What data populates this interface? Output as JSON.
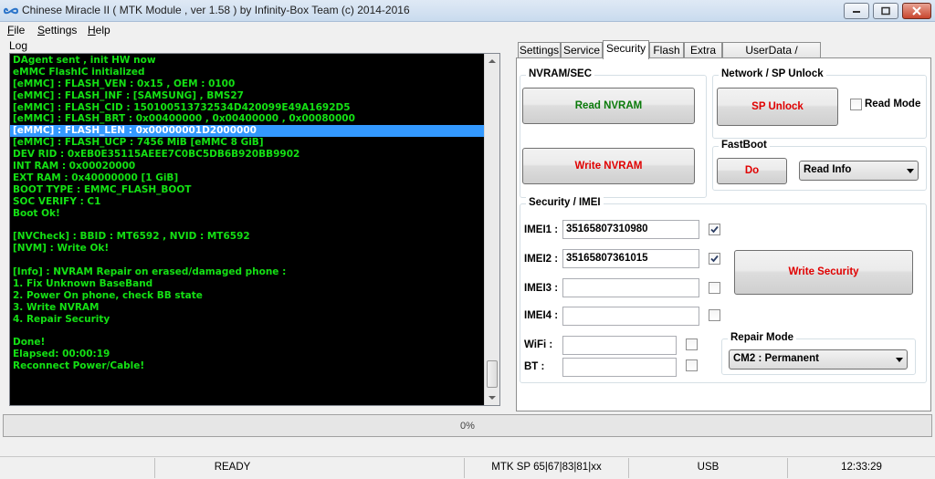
{
  "window": {
    "title": "Chinese Miracle II ( MTK Module , ver 1.58 ) by Infinity-Box Team (c) 2014-2016",
    "icon": "infinity-icon"
  },
  "menu": [
    "File",
    "Settings",
    "Help"
  ],
  "log": {
    "label": "Log",
    "lines": [
      "DAgent sent , init HW now",
      "eMMC FlashIC initialized",
      "[eMMC] : FLASH_VEN : 0x15 , OEM : 0100",
      "[eMMC] : FLASH_INF : [SAMSUNG] , BMS27",
      "[eMMC] : FLASH_CID : 150100513732534D420099E49A1692D5",
      "[eMMC] : FLASH_BRT : 0x00400000 , 0x00400000 , 0x00080000",
      "[eMMC] : FLASH_LEN : 0x00000001D2000000",
      "[eMMC] : FLASH_UCP : 7456 MiB [eMMC 8 GiB]",
      "DEV RID    : 0xEB0E35115AEEE7C0BC5DB6B920BB9902",
      "INT RAM    : 0x00020000",
      "EXT RAM    : 0x40000000 [1 GiB]",
      "BOOT TYPE  : EMMC_FLASH_BOOT",
      "SOC VERIFY : C1",
      "Boot Ok!",
      "",
      "[NVCheck] : BBID : MT6592 , NVID : MT6592",
      "[NVM] : Write Ok!",
      "",
      "[Info] : NVRAM Repair on erased/damaged phone :",
      "1. Fix Unknown BaseBand",
      "2. Power On phone, check BB state",
      "3. Write NVRAM",
      "4. Repair Security",
      "",
      "Done!",
      "Elapsed: 00:00:19",
      "Reconnect Power/Cable!"
    ],
    "selected_line": "[eMMC] : FLASH_LEN : 0x00000001D2000000"
  },
  "tabs": [
    "Settings",
    "Service",
    "Security",
    "Flash",
    "Extra",
    "UserData / Forensic"
  ],
  "active_tab": "Security",
  "security": {
    "nvram_title": "NVRAM/SEC",
    "read_nvram": "Read NVRAM",
    "write_nvram": "Write NVRAM",
    "network_title": "Network / SP Unlock",
    "sp_unlock": "SP Unlock",
    "read_mode": "Read Mode",
    "read_mode_checked": false,
    "fastboot_title": "FastBoot",
    "fastboot_do": "Do",
    "fastboot_option": "Read Info",
    "imei_title": "Security / IMEI",
    "imei": [
      {
        "label": "IMEI1 :",
        "value": "35165807310980",
        "checked": true
      },
      {
        "label": "IMEI2 :",
        "value": "35165807361015",
        "checked": true
      },
      {
        "label": "IMEI3 :",
        "value": "",
        "checked": false
      },
      {
        "label": "IMEI4 :",
        "value": "",
        "checked": false
      }
    ],
    "wifi_label": "WiFi :",
    "wifi_value": "",
    "bt_label": "BT :",
    "bt_value": "",
    "write_security": "Write Security",
    "repair_mode_title": "Repair Mode",
    "repair_mode": "CM2 : Permanent"
  },
  "progress": {
    "percent": 0,
    "text": "0%"
  },
  "status": [
    "READY",
    "MTK SP 65|67|83|81|xx",
    "USB",
    "12:33:29"
  ],
  "colors": {
    "log_text": "#14e014",
    "log_bg": "#000000",
    "selection": "#3399ff",
    "green_button": "#0a7a0a",
    "red_button": "#e00000"
  }
}
